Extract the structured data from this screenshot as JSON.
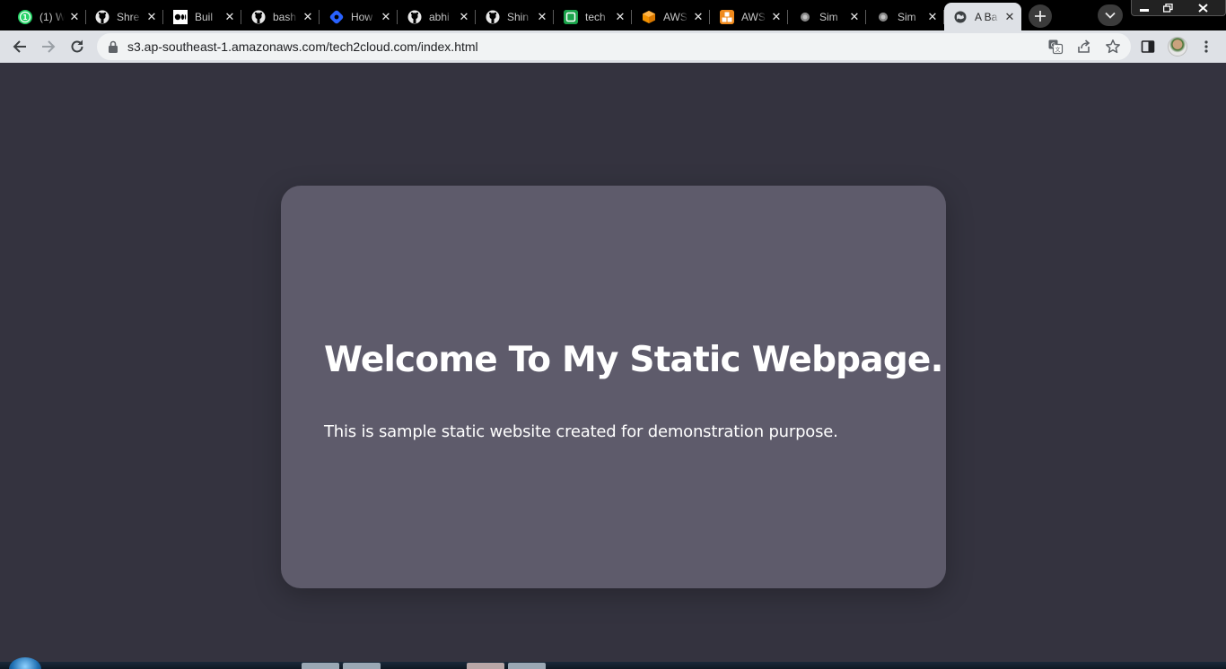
{
  "tabs": [
    {
      "title": "(1) W",
      "icon": "whatsapp-icon"
    },
    {
      "title": "Shre",
      "icon": "github-icon"
    },
    {
      "title": "Buil",
      "icon": "medium-icon"
    },
    {
      "title": "bash",
      "icon": "github-icon"
    },
    {
      "title": "How",
      "icon": "hashnode-icon"
    },
    {
      "title": "abhi",
      "icon": "github-icon"
    },
    {
      "title": "Shin",
      "icon": "github-icon"
    },
    {
      "title": "tech",
      "icon": "green-square-icon"
    },
    {
      "title": "AWS",
      "icon": "aws-cube-icon"
    },
    {
      "title": "AWS",
      "icon": "aws-orange-icon"
    },
    {
      "title": "Sim",
      "icon": "dot-icon"
    },
    {
      "title": "Sim",
      "icon": "dot-icon"
    },
    {
      "title": "A Ba",
      "icon": "globe-icon",
      "active": true
    }
  ],
  "tab_badge": "1",
  "address_bar": {
    "url": "s3.ap-southeast-1.amazonaws.com/tech2cloud.com/index.html"
  },
  "page": {
    "heading": "Welcome To My Static Webpage.",
    "description": "This is sample static website created for demonstration purpose."
  },
  "colors": {
    "page_background": "#34333f",
    "card_background": "#5e5b6b",
    "tabstrip": "#000000",
    "toolbar": "#dee1e6"
  }
}
